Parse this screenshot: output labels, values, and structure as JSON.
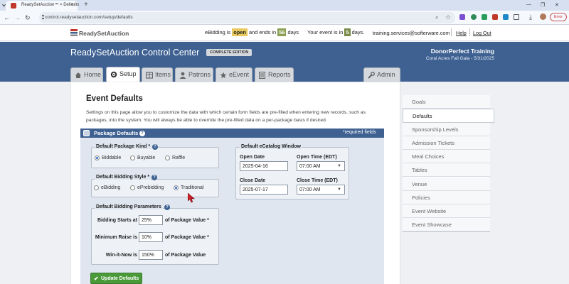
{
  "browser": {
    "tab_title": "ReadySetAuction™ > Defaults",
    "new_tab": "+",
    "url": "control.readysetauction.com/setup/defaults",
    "error_label": "Error"
  },
  "site_header": {
    "logo": "ReadySetAuction",
    "ebidding_prefix": "eBidding is",
    "ebidding_status": "open",
    "ebidding_mid": "and ends in",
    "ebidding_days": "56",
    "ebidding_suffix": "days",
    "event_prefix": "Your event is in",
    "event_days": "5",
    "event_suffix": "days.",
    "email": "training.services@softerware.com",
    "help": "Help",
    "logout": "Log Out"
  },
  "banner": {
    "title": "ReadySetAuction Control Center",
    "edition": "COMPLETE EDITION",
    "org": "DonorPerfect Training",
    "event": "Coral Acres Fall Gala - 5/31/2025"
  },
  "nav": {
    "home": "Home",
    "setup": "Setup",
    "items": "Items",
    "patrons": "Patrons",
    "eevent": "eEvent",
    "reports": "Reports",
    "admin": "Admin"
  },
  "page": {
    "title": "Event Defaults",
    "description": "Settings on this page allow you to customize the data with which certain form fields are pre-filled when entering new records, such as packages, into the system. You will always be able to override the pre-filled data on a per-package basis if desired."
  },
  "package_defaults": {
    "header": "Package Defaults",
    "required_note": "*required fields",
    "kind": {
      "legend": "Default Package Kind *",
      "options": [
        "Biddable",
        "Buyable",
        "Raffle"
      ],
      "selected": "Biddable"
    },
    "style": {
      "legend": "Default Bidding Style *",
      "options": [
        "eBidding",
        "ePrebidding",
        "Traditional"
      ],
      "selected": "Traditional"
    },
    "params": {
      "legend": "Default Bidding Parameters",
      "starts_label": "Bidding Starts at",
      "starts_value": "25%",
      "starts_suffix": "of Package Value *",
      "raise_label": "Minimum Raise is",
      "raise_value": "10%",
      "raise_suffix": "of Package Value *",
      "win_label": "Win-it-Now is",
      "win_value": "150%",
      "win_suffix": "of Package Value"
    },
    "ecatalog": {
      "legend": "Default eCatalog Window",
      "open_date_label": "Open Date",
      "open_date": "2025-04-16",
      "open_time_label": "Open Time (EDT)",
      "open_time": "07:00 AM",
      "close_date_label": "Close Date",
      "close_date": "2025-07-17",
      "close_time_label": "Close Time (EDT)",
      "close_time": "07:00 AM"
    },
    "update_button": "Update Defaults"
  },
  "side_menu": {
    "items": [
      "Goals",
      "Defaults",
      "Sponsorship Levels",
      "Admission Tickets",
      "Meal Choices",
      "Tables",
      "Venue",
      "Policies",
      "Event Website",
      "Event Showcase"
    ],
    "active": "Defaults"
  },
  "colors": {
    "banner": "#3e6192",
    "accent_green": "#4a9a3a",
    "highlight_yellow": "#e8c95e"
  }
}
